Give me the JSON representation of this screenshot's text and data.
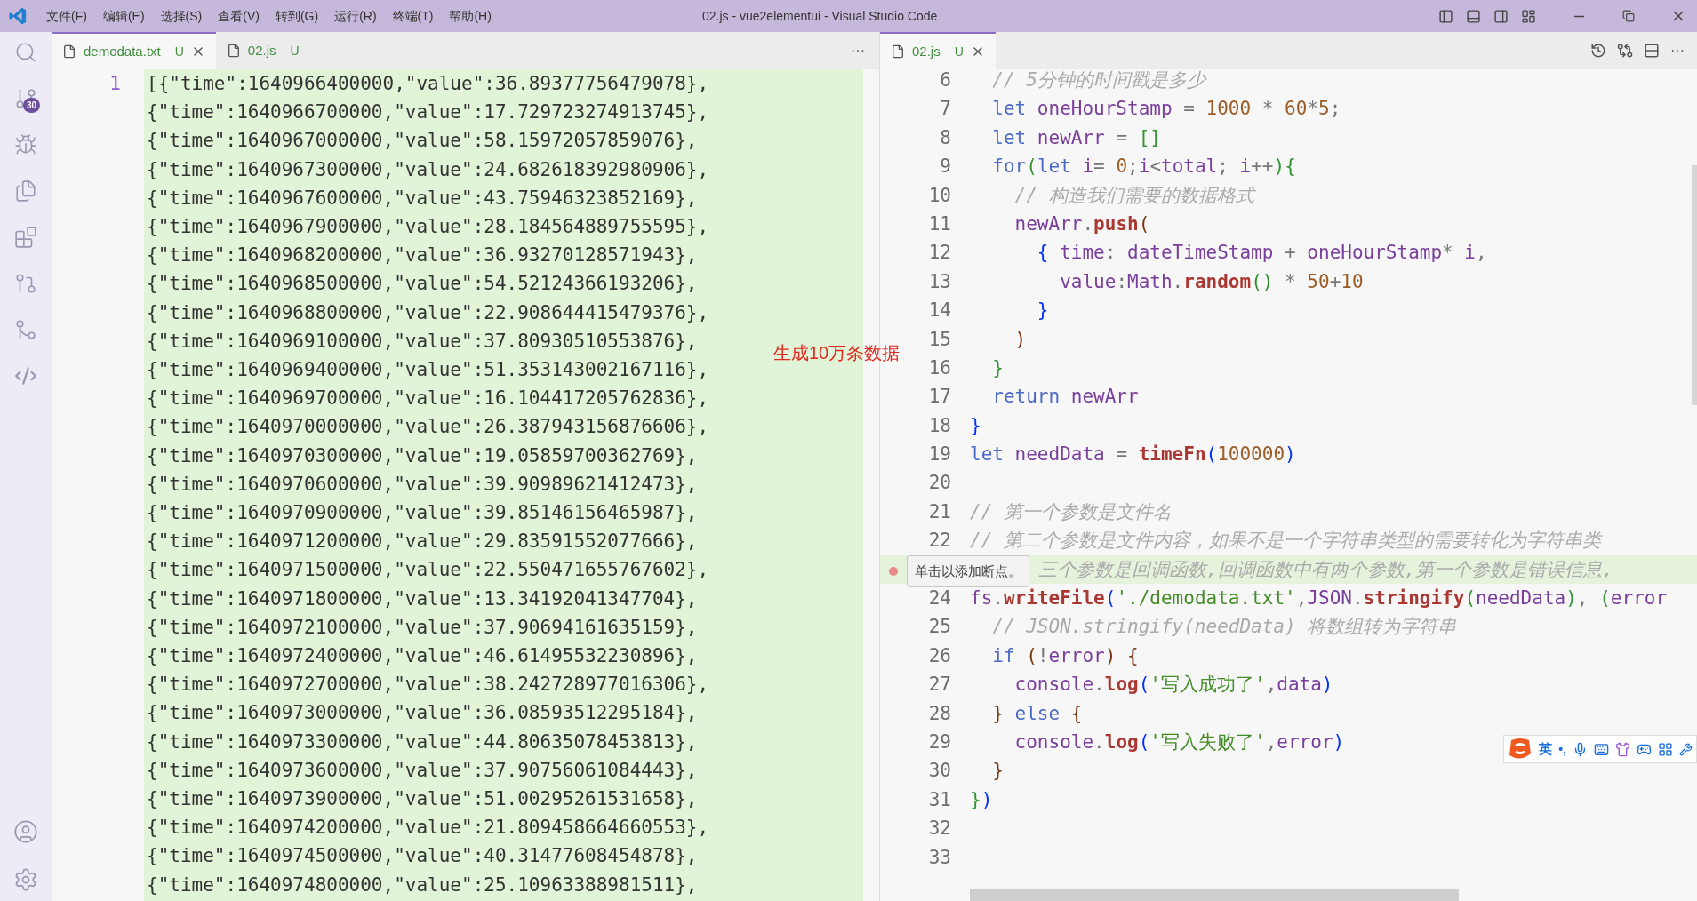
{
  "window": {
    "title": "02.js - vue2elementui - Visual Studio Code"
  },
  "menu": [
    "文件(F)",
    "编辑(E)",
    "选择(S)",
    "查看(V)",
    "转到(G)",
    "运行(R)",
    "终端(T)",
    "帮助(H)"
  ],
  "activity_bar": {
    "source_control_badge": "30"
  },
  "left_group": {
    "tabs": [
      {
        "label": "demodata.txt",
        "status": "U",
        "selected": true
      },
      {
        "label": "02.js",
        "status": "U",
        "selected": false
      }
    ],
    "more": "···"
  },
  "right_group": {
    "tabs": [
      {
        "label": "02.js",
        "status": "U",
        "selected": true
      }
    ],
    "more": "···"
  },
  "left_editor": {
    "highlighted": true,
    "first_line_number": "1",
    "lines": [
      "[{\"time\":1640966400000,\"value\":36.89377756479078},",
      "{\"time\":1640966700000,\"value\":17.729723274913745},",
      "{\"time\":1640967000000,\"value\":58.15972057859076},",
      "{\"time\":1640967300000,\"value\":24.682618392980906},",
      "{\"time\":1640967600000,\"value\":43.75946323852169},",
      "{\"time\":1640967900000,\"value\":28.184564889755595},",
      "{\"time\":1640968200000,\"value\":36.93270128571943},",
      "{\"time\":1640968500000,\"value\":54.52124366193206},",
      "{\"time\":1640968800000,\"value\":22.908644415479376},",
      "{\"time\":1640969100000,\"value\":37.80930510553876},",
      "{\"time\":1640969400000,\"value\":51.353143002167116},",
      "{\"time\":1640969700000,\"value\":16.104417205762836},",
      "{\"time\":1640970000000,\"value\":26.387943156876606},",
      "{\"time\":1640970300000,\"value\":19.05859700362769},",
      "{\"time\":1640970600000,\"value\":39.90989621412473},",
      "{\"time\":1640970900000,\"value\":39.85146156465987},",
      "{\"time\":1640971200000,\"value\":29.83591552077666},",
      "{\"time\":1640971500000,\"value\":22.550471655767602},",
      "{\"time\":1640971800000,\"value\":13.34192041347704},",
      "{\"time\":1640972100000,\"value\":37.90694161635159},",
      "{\"time\":1640972400000,\"value\":46.61495532230896},",
      "{\"time\":1640972700000,\"value\":38.242728977016306},",
      "{\"time\":1640973000000,\"value\":36.08593512295184},",
      "{\"time\":1640973300000,\"value\":44.80635078453813},",
      "{\"time\":1640973600000,\"value\":37.90756061084443},",
      "{\"time\":1640973900000,\"value\":51.00295261531658},",
      "{\"time\":1640974200000,\"value\":21.809458664660553},",
      "{\"time\":1640974500000,\"value\":40.31477608454878},",
      "{\"time\":1640974800000,\"value\":25.10963388981511},"
    ]
  },
  "annotation": "生成10万条数据",
  "right_editor": {
    "lines": [
      {
        "number": "6",
        "tokens": [
          {
            "text": "  // 5分钟的时间戳是多少",
            "kind": "cm"
          }
        ]
      },
      {
        "number": "7",
        "tokens": [
          {
            "text": "  let",
            "kind": "kw"
          },
          {
            "text": " oneHourStamp",
            "kind": "id"
          },
          {
            "text": " = ",
            "kind": "op"
          },
          {
            "text": "1000",
            "kind": "num"
          },
          {
            "text": " * ",
            "kind": "op"
          },
          {
            "text": "60",
            "kind": "num"
          },
          {
            "text": "*",
            "kind": "op"
          },
          {
            "text": "5",
            "kind": "num"
          },
          {
            "text": ";",
            "kind": "op"
          }
        ]
      },
      {
        "number": "8",
        "tokens": [
          {
            "text": "  let",
            "kind": "kw"
          },
          {
            "text": " newArr",
            "kind": "id"
          },
          {
            "text": " = ",
            "kind": "op"
          },
          {
            "text": "[]",
            "kind": "b2"
          }
        ]
      },
      {
        "number": "9",
        "tokens": [
          {
            "text": "  for",
            "kind": "kw"
          },
          {
            "text": "(",
            "kind": "b2"
          },
          {
            "text": "let",
            "kind": "kw"
          },
          {
            "text": " i",
            "kind": "id"
          },
          {
            "text": "= ",
            "kind": "op"
          },
          {
            "text": "0",
            "kind": "num"
          },
          {
            "text": ";",
            "kind": "op"
          },
          {
            "text": "i",
            "kind": "id"
          },
          {
            "text": "<",
            "kind": "op"
          },
          {
            "text": "total",
            "kind": "id"
          },
          {
            "text": "; ",
            "kind": "op"
          },
          {
            "text": "i",
            "kind": "id"
          },
          {
            "text": "++",
            "kind": "op"
          },
          {
            "text": ")",
            "kind": "b2"
          },
          {
            "text": "{",
            "kind": "b2"
          }
        ]
      },
      {
        "number": "10",
        "tokens": [
          {
            "text": "    // 构造我们需要的数据格式",
            "kind": "cm"
          }
        ]
      },
      {
        "number": "11",
        "tokens": [
          {
            "text": "    newArr",
            "kind": "id"
          },
          {
            "text": ".",
            "kind": "op"
          },
          {
            "text": "push",
            "kind": "fn"
          },
          {
            "text": "(",
            "kind": "b3"
          }
        ]
      },
      {
        "number": "12",
        "tokens": [
          {
            "text": "      {",
            "kind": "b1"
          },
          {
            "text": " time",
            "kind": "id"
          },
          {
            "text": ": ",
            "kind": "op"
          },
          {
            "text": "dateTimeStamp",
            "kind": "id"
          },
          {
            "text": " + ",
            "kind": "op"
          },
          {
            "text": "oneHourStamp",
            "kind": "id"
          },
          {
            "text": "* ",
            "kind": "op"
          },
          {
            "text": "i",
            "kind": "id"
          },
          {
            "text": ",",
            "kind": "op"
          }
        ]
      },
      {
        "number": "13",
        "tokens": [
          {
            "text": "        value",
            "kind": "id"
          },
          {
            "text": ":",
            "kind": "op"
          },
          {
            "text": "Math",
            "kind": "id"
          },
          {
            "text": ".",
            "kind": "op"
          },
          {
            "text": "random",
            "kind": "fn"
          },
          {
            "text": "()",
            "kind": "b2"
          },
          {
            "text": " * ",
            "kind": "op"
          },
          {
            "text": "50",
            "kind": "num"
          },
          {
            "text": "+",
            "kind": "op"
          },
          {
            "text": "10",
            "kind": "num"
          }
        ]
      },
      {
        "number": "14",
        "tokens": [
          {
            "text": "      }",
            "kind": "b1"
          }
        ]
      },
      {
        "number": "15",
        "tokens": [
          {
            "text": "    )",
            "kind": "b3"
          }
        ]
      },
      {
        "number": "16",
        "tokens": [
          {
            "text": "  }",
            "kind": "b2"
          }
        ]
      },
      {
        "number": "17",
        "tokens": [
          {
            "text": "  return",
            "kind": "kw"
          },
          {
            "text": " newArr",
            "kind": "id"
          }
        ]
      },
      {
        "number": "18",
        "tokens": [
          {
            "text": "}",
            "kind": "b1"
          }
        ]
      },
      {
        "number": "19",
        "tokens": [
          {
            "text": "let",
            "kind": "kw"
          },
          {
            "text": " needData",
            "kind": "id"
          },
          {
            "text": " = ",
            "kind": "op"
          },
          {
            "text": "timeFn",
            "kind": "fn"
          },
          {
            "text": "(",
            "kind": "b1"
          },
          {
            "text": "100000",
            "kind": "num"
          },
          {
            "text": ")",
            "kind": "b1"
          }
        ]
      },
      {
        "number": "20"
      },
      {
        "number": "21",
        "tokens": [
          {
            "text": "// 第一个参数是文件名",
            "kind": "cm"
          }
        ]
      },
      {
        "number": "22",
        "tokens": [
          {
            "text": "// 第二个参数是文件内容，如果不是一个字符串类型的需要转化为字符串类",
            "kind": "cm"
          }
        ]
      },
      {
        "highlighted": true,
        "tokens": [
          {
            "text": "三个参数是回调函数,回调函数中有两个参数,第一个参数是错误信息,",
            "kind": "cm"
          }
        ]
      },
      {
        "number": "24",
        "tokens": [
          {
            "text": "fs",
            "kind": "id"
          },
          {
            "text": ".",
            "kind": "op"
          },
          {
            "text": "writeFile",
            "kind": "fn"
          },
          {
            "text": "(",
            "kind": "b1"
          },
          {
            "text": "'./demodata.txt'",
            "kind": "str"
          },
          {
            "text": ",",
            "kind": "op"
          },
          {
            "text": "JSON",
            "kind": "id"
          },
          {
            "text": ".",
            "kind": "op"
          },
          {
            "text": "stringify",
            "kind": "fn"
          },
          {
            "text": "(",
            "kind": "b2"
          },
          {
            "text": "needData",
            "kind": "id"
          },
          {
            "text": ")",
            "kind": "b2"
          },
          {
            "text": ", ",
            "kind": "op"
          },
          {
            "text": "(",
            "kind": "b2"
          },
          {
            "text": "error",
            "kind": "id"
          }
        ]
      },
      {
        "number": "25",
        "tokens": [
          {
            "text": "  // JSON.stringify(needData) 将数组转为字符串",
            "kind": "cm"
          }
        ]
      },
      {
        "number": "26",
        "tokens": [
          {
            "text": "  if",
            "kind": "kw"
          },
          {
            "text": " (",
            "kind": "b3"
          },
          {
            "text": "!",
            "kind": "op"
          },
          {
            "text": "error",
            "kind": "id"
          },
          {
            "text": ")",
            "kind": "b3"
          },
          {
            "text": " {",
            "kind": "b3"
          }
        ]
      },
      {
        "number": "27",
        "tokens": [
          {
            "text": "    console",
            "kind": "id"
          },
          {
            "text": ".",
            "kind": "op"
          },
          {
            "text": "log",
            "kind": "fn"
          },
          {
            "text": "(",
            "kind": "b1"
          },
          {
            "text": "'写入成功了'",
            "kind": "str"
          },
          {
            "text": ",",
            "kind": "op"
          },
          {
            "text": "data",
            "kind": "id"
          },
          {
            "text": ")",
            "kind": "b1"
          }
        ]
      },
      {
        "number": "28",
        "tokens": [
          {
            "text": "  }",
            "kind": "b3"
          },
          {
            "text": " else",
            "kind": "kw"
          },
          {
            "text": " {",
            "kind": "b3"
          }
        ]
      },
      {
        "number": "29",
        "tokens": [
          {
            "text": "    console",
            "kind": "id"
          },
          {
            "text": ".",
            "kind": "op"
          },
          {
            "text": "log",
            "kind": "fn"
          },
          {
            "text": "(",
            "kind": "b1"
          },
          {
            "text": "'写入失败了'",
            "kind": "str"
          },
          {
            "text": ",",
            "kind": "op"
          },
          {
            "text": "error",
            "kind": "id"
          },
          {
            "text": ")",
            "kind": "b1"
          }
        ]
      },
      {
        "number": "30",
        "tokens": [
          {
            "text": "  }",
            "kind": "b3"
          }
        ]
      },
      {
        "number": "31",
        "tokens": [
          {
            "text": "}",
            "kind": "b2"
          },
          {
            "text": ")",
            "kind": "b1"
          }
        ]
      },
      {
        "number": "32"
      },
      {
        "number": "33"
      }
    ]
  },
  "breakpoint_tooltip": "单击以添加断点。",
  "ime_toolbar": {
    "mode": "英",
    "punct": "•,"
  }
}
